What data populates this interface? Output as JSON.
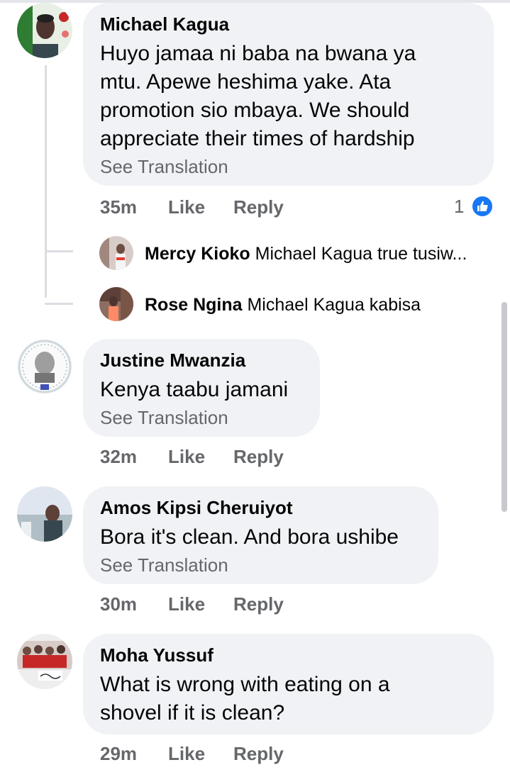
{
  "comments": [
    {
      "author": "Michael Kagua",
      "text_lines": [
        "Huyo jamaa ni baba na bwana ya",
        "mtu. Apewe heshima yake. Ata",
        "promotion sio mbaya. We should",
        "appreciate their times of hardship"
      ],
      "see_translation": "See Translation",
      "time": "35m",
      "like": "Like",
      "reply": "Reply",
      "reaction_count": "1",
      "reaction_icon": "like-thumb-icon",
      "replies": [
        {
          "author": "Mercy Kioko",
          "text": "Michael Kagua true tusiw..."
        },
        {
          "author": "Rose Ngina",
          "text": "Michael Kagua kabisa"
        }
      ]
    },
    {
      "author": "Justine Mwanzia",
      "text_lines": [
        "Kenya taabu jamani"
      ],
      "see_translation": "See Translation",
      "time": "32m",
      "like": "Like",
      "reply": "Reply"
    },
    {
      "author": "Amos Kipsi Cheruiyot",
      "text_lines": [
        "Bora it's clean. And bora ushibe"
      ],
      "see_translation": "See Translation",
      "time": "30m",
      "like": "Like",
      "reply": "Reply"
    },
    {
      "author": "Moha Yussuf",
      "text_lines": [
        "What is wrong with eating on a",
        "shovel if it is clean?"
      ],
      "time": "29m",
      "like": "Like",
      "reply": "Reply"
    }
  ],
  "colors": {
    "bubble": "#f0f2f5",
    "secondary_text": "#65676b",
    "like_blue": "#1877f2"
  }
}
